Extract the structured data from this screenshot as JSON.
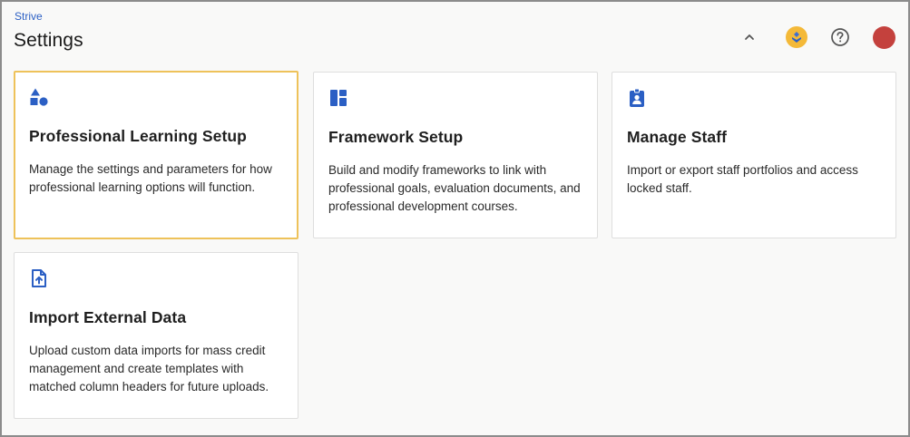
{
  "header": {
    "breadcrumb": "Strive",
    "title": "Settings",
    "actions": {
      "collapse_icon": "chevron-up-icon",
      "org_icon": "org-logo-icon",
      "help_icon": "help-circle-icon",
      "avatar_icon": "user-avatar"
    }
  },
  "cards": [
    {
      "title": "Professional Learning Setup",
      "description": "Manage the settings and parameters for how professional learning options will function.",
      "icon": "shapes-icon",
      "selected": true
    },
    {
      "title": "Framework Setup",
      "description": "Build and modify frameworks to link with professional goals, evaluation documents, and professional development courses.",
      "icon": "dashboard-layout-icon",
      "selected": false
    },
    {
      "title": "Manage Staff",
      "description": "Import or export staff portfolios and access locked staff.",
      "icon": "badge-icon",
      "selected": false
    },
    {
      "title": "Import External Data",
      "description": "Upload custom data imports for mass credit management and create templates with matched column headers for future uploads.",
      "icon": "file-upload-icon",
      "selected": false
    }
  ],
  "colors": {
    "accent_blue": "#2b5fc4",
    "selected_border": "#eec25a",
    "avatar": "#c4413d",
    "org_logo": "#f4b938"
  }
}
